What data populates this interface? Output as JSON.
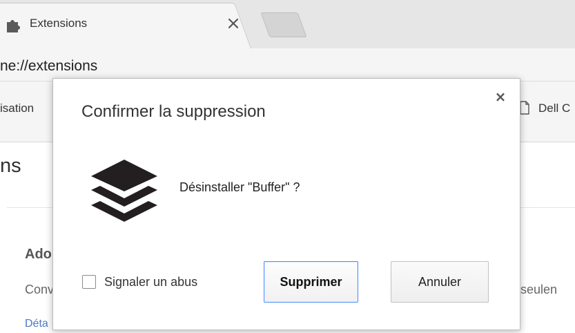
{
  "browser": {
    "tab": {
      "title": "Extensions",
      "close_glyph": "×",
      "icon": "puzzle-icon"
    },
    "newtab_icon": "new-tab-icon",
    "url_visible": "ne://extensions",
    "bookmarks": {
      "left_partial": "isation",
      "right_icon": "page-icon",
      "right_partial": "Dell C"
    }
  },
  "page": {
    "heading_partial": "ns",
    "extension": {
      "name_partial": "Ado",
      "desc_left_partial": "Conv",
      "desc_right_partial": "s seulen",
      "details_partial": "Déta"
    }
  },
  "dialog": {
    "title": "Confirmer la suppression",
    "close_glyph": "×",
    "icon": "buffer-logo-icon",
    "message": "Désinstaller \"Buffer\" ?",
    "report_abuse": {
      "label": "Signaler un abus",
      "checked": false
    },
    "primary_button": "Supprimer",
    "secondary_button": "Annuler",
    "colors": {
      "primary_border": "#4d90fe",
      "logo": "#231f20"
    }
  }
}
